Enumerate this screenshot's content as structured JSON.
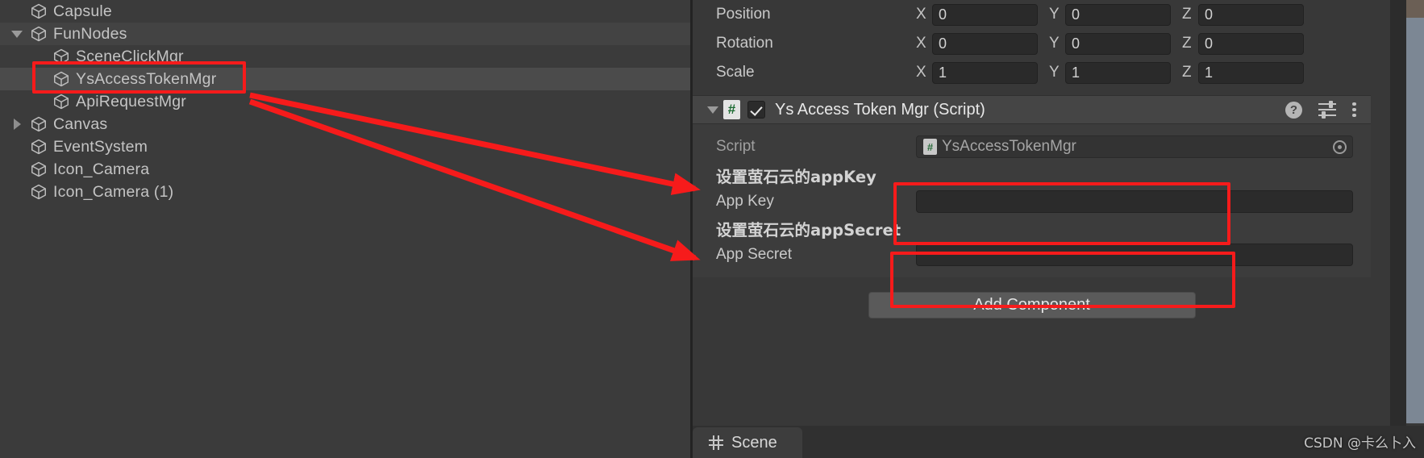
{
  "hierarchy": {
    "rows": [
      {
        "label": "Capsule",
        "indent": 0,
        "fold": "none",
        "icon": "cube-icon",
        "state": "normal"
      },
      {
        "label": "FunNodes",
        "indent": 0,
        "fold": "down",
        "icon": "cube-icon",
        "state": "alt"
      },
      {
        "label": "SceneClickMgr",
        "indent": 1,
        "fold": "none",
        "icon": "cube-icon",
        "state": "normal"
      },
      {
        "label": "YsAccessTokenMgr",
        "indent": 1,
        "fold": "none",
        "icon": "cube-icon",
        "state": "selected"
      },
      {
        "label": "ApiRequestMgr",
        "indent": 1,
        "fold": "none",
        "icon": "cube-icon",
        "state": "normal"
      },
      {
        "label": "Canvas",
        "indent": 0,
        "fold": "right",
        "icon": "cube-icon",
        "state": "normal"
      },
      {
        "label": "EventSystem",
        "indent": 0,
        "fold": "none",
        "icon": "cube-icon",
        "state": "normal"
      },
      {
        "label": "Icon_Camera",
        "indent": 0,
        "fold": "none",
        "icon": "cube-icon",
        "state": "normal"
      },
      {
        "label": "Icon_Camera (1)",
        "indent": 0,
        "fold": "none",
        "icon": "cube-icon",
        "state": "normal"
      }
    ]
  },
  "inspector": {
    "transform": {
      "rows": [
        {
          "label": "Position",
          "x": "0",
          "y": "0",
          "z": "0"
        },
        {
          "label": "Rotation",
          "x": "0",
          "y": "0",
          "z": "0"
        },
        {
          "label": "Scale",
          "x": "1",
          "y": "1",
          "z": "1"
        }
      ],
      "axis_x": "X",
      "axis_y": "Y",
      "axis_z": "Z"
    },
    "component": {
      "title": "Ys Access Token Mgr (Script)",
      "script_icon_glyph": "#",
      "enabled": true,
      "help_icon": "?",
      "icons": {
        "help": "help-icon",
        "preset": "preset-icon",
        "more": "more-options-icon"
      },
      "script_field": {
        "label": "Script",
        "value": "YsAccessTokenMgr",
        "icon_glyph": "#"
      },
      "fields": [
        {
          "header": "设置萤石云的appKey",
          "label": "App Key",
          "value": "",
          "highlight_color": "#f61b1b"
        },
        {
          "header": "设置萤石云的appSecret",
          "label": "App Secret",
          "value": "",
          "highlight_color": "#f61b1b"
        }
      ]
    },
    "add_component_label": "Add Component"
  },
  "bottom": {
    "scene_tab_label": "Scene",
    "scene_tab_icon": "grid-icon"
  },
  "watermark": "CSDN @卡么卜入",
  "colors": {
    "annotation_red": "#f61b1b",
    "panel_bg": "#383838",
    "hierarchy_bg": "#3b3b3b",
    "selected_row": "#4b4b4b",
    "component_header": "#454545"
  }
}
